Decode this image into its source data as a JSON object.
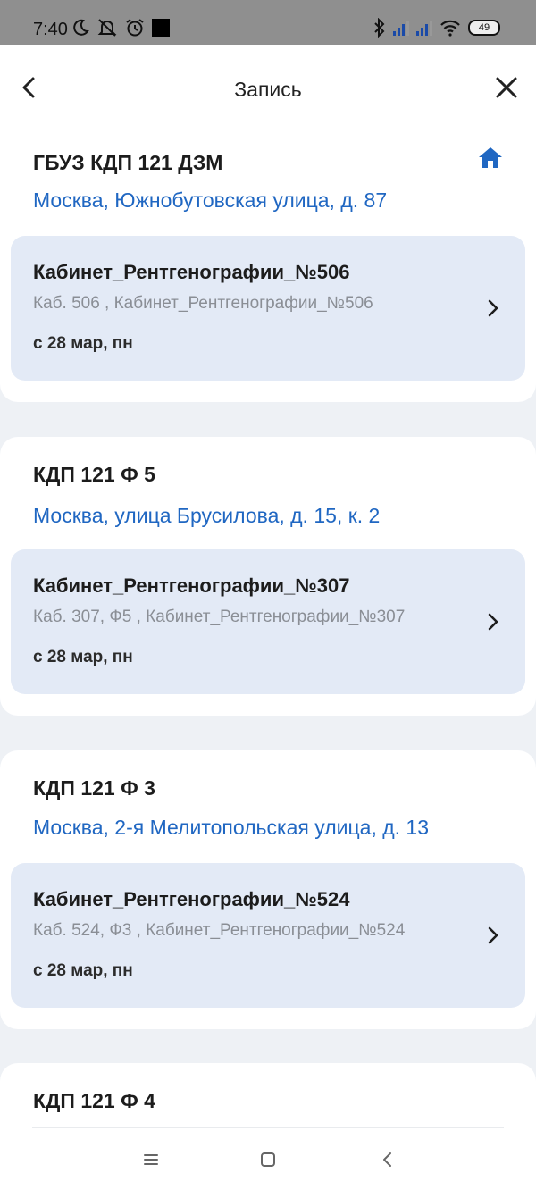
{
  "status_bar": {
    "time": "7:40",
    "battery": "49",
    "icons": [
      "moon-icon",
      "notifications-off-icon",
      "alarm-icon",
      "black-square-icon",
      "bluetooth-icon",
      "signal-icon",
      "signal-icon",
      "wifi-icon",
      "battery-icon"
    ]
  },
  "header": {
    "title": "Запись",
    "back_icon": "chevron-left-icon",
    "close_icon": "close-icon"
  },
  "colors": {
    "accent": "#2067c2",
    "room_bg": "#e3eaf6",
    "page_bg": "#eef1f5"
  },
  "locations": [
    {
      "name": "ГБУЗ КДП 121 ДЗМ",
      "address": "Москва, Южнобутовская улица, д. 87",
      "home_icon": true,
      "room": {
        "title": "Кабинет_Рентгенографии_№506",
        "subtitle": "Каб. 506 , Кабинет_Рентгенографии_№506",
        "date": "с 28 мар, пн"
      }
    },
    {
      "name": "КДП 121 Ф 5",
      "address": "Москва, улица Брусилова, д. 15, к. 2",
      "room": {
        "title": "Кабинет_Рентгенографии_№307",
        "subtitle": "Каб. 307, Ф5 , Кабинет_Рентгенографии_№307",
        "date": "с 28 мар, пн"
      }
    },
    {
      "name": "КДП 121 Ф 3",
      "address": "Москва, 2-я Мелитопольская улица, д. 13",
      "room": {
        "title": "Кабинет_Рентгенографии_№524",
        "subtitle": "Каб. 524, Ф3 , Кабинет_Рентгенографии_№524",
        "date": "с 28 мар, пн"
      }
    },
    {
      "name": "КДП 121 Ф 4"
    }
  ],
  "nav_bar": {
    "icons": [
      "menu-icon",
      "home-square-icon",
      "back-icon"
    ]
  }
}
